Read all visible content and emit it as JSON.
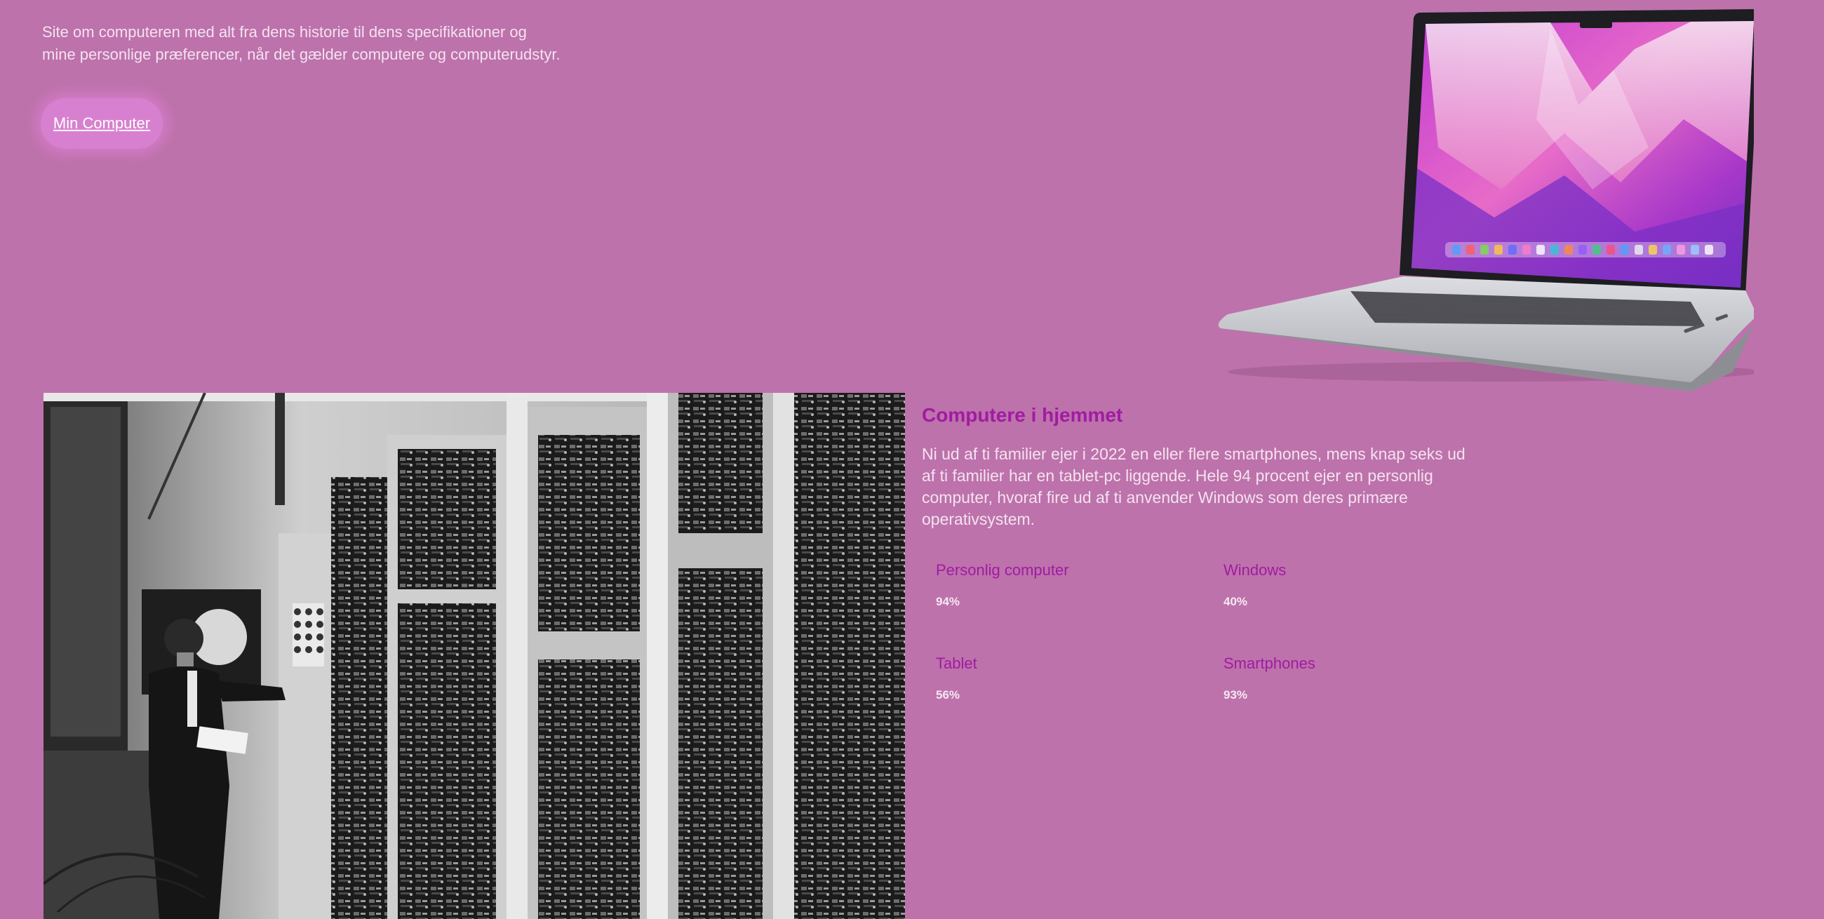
{
  "hero": {
    "intro_line1": "Site om computeren med alt fra dens historie til dens specifikationer og",
    "intro_line2": "mine personlige præferencer, når det gælder computere og computerudstyr.",
    "cta_label": "Min Computer"
  },
  "section": {
    "title": "Computere i hjemmet",
    "body": "Ni ud af ti familier ejer i 2022 en eller flere smartphones, mens knap seks ud af ti familier har en tablet-pc liggende. Hele 94 procent ejer en personlig computer, hvoraf fire ud af ti anvender Windows som deres primære operativsystem."
  },
  "stats": [
    {
      "label": "Personlig computer",
      "value": "94%"
    },
    {
      "label": "Windows",
      "value": "40%"
    },
    {
      "label": "Tablet",
      "value": "56%"
    },
    {
      "label": "Smartphones",
      "value": "93%"
    }
  ],
  "images": {
    "laptop": "laptop-image",
    "mainframe": "mainframe-computer-photo"
  },
  "colors": {
    "background": "#bd72ab",
    "accent": "#a01ba2",
    "button": "#d880d0"
  }
}
